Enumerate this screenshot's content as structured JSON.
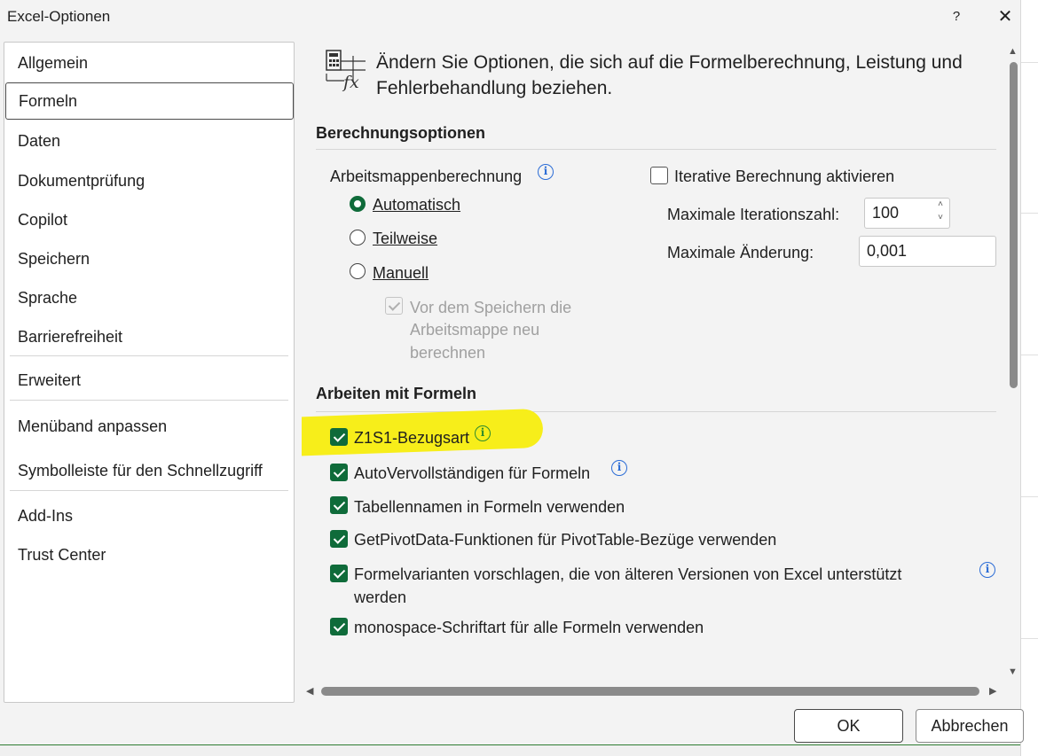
{
  "window": {
    "title": "Excel-Optionen",
    "help_label": "?",
    "close_label": "✕"
  },
  "nav": {
    "items": [
      {
        "label": "Allgemein"
      },
      {
        "label": "Formeln",
        "selected": true
      },
      {
        "label": "Daten"
      },
      {
        "label": "Dokumentprüfung"
      },
      {
        "label": "Copilot"
      },
      {
        "label": "Speichern"
      },
      {
        "label": "Sprache"
      },
      {
        "label": "Barrierefreiheit"
      },
      {
        "label": "Erweitert"
      },
      {
        "label": "Menüband anpassen"
      },
      {
        "label": "Symbolleiste für den Schnellzugriff"
      },
      {
        "label": "Add-Ins"
      },
      {
        "label": "Trust Center"
      }
    ]
  },
  "header": {
    "text": "Ändern Sie Optionen, die sich auf die Formelberechnung, Leistung und Fehlerbehandlung beziehen.",
    "icon": "formula-calculator-icon"
  },
  "calc": {
    "heading": "Berechnungsoptionen",
    "workbook_label": "Arbeitsmappenberechnung",
    "auto_label": "Automatisch",
    "partial_label": "Teilweise",
    "manual_label": "Manuell",
    "selected": "Automatisch",
    "save_recalc_label_1": "Vor dem Speichern die",
    "save_recalc_label_2": "Arbeitsmappe neu",
    "save_recalc_label_3": "berechnen",
    "iterative_label": "Iterative Berechnung aktivieren",
    "iterative_checked": false,
    "max_iter_label": "Maximale Iterationszahl:",
    "max_iter_value": "100",
    "max_change_label": "Maximale Änderung:",
    "max_change_value": "0,001"
  },
  "formulas": {
    "heading": "Arbeiten mit Formeln",
    "options": [
      {
        "label": "Z1S1-Bezugsart",
        "checked": true,
        "highlighted": true
      },
      {
        "label": "AutoVervollständigen für Formeln",
        "checked": true
      },
      {
        "label": "Tabellennamen in Formeln verwenden",
        "checked": true
      },
      {
        "label": "GetPivotData-Funktionen für PivotTable-Bezüge verwenden",
        "checked": true
      },
      {
        "label_1": "Formelvarianten vorschlagen, die von älteren Versionen von Excel unterstützt",
        "label_2": "werden",
        "checked": true
      },
      {
        "label": "monospace-Schriftart für alle Formeln verwenden",
        "checked": true
      }
    ]
  },
  "footer": {
    "ok_label": "OK",
    "cancel_label": "Abbrechen"
  },
  "colors": {
    "accent": "#0f6b3a",
    "info": "#2b6cd6",
    "highlight": "#f7ee1a"
  }
}
